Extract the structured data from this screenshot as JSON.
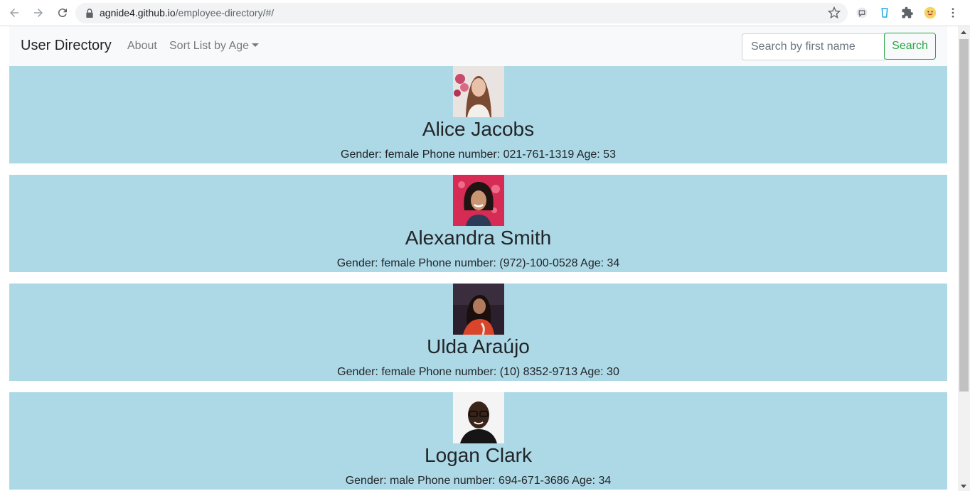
{
  "browser": {
    "url_host": "agnide4.github.io",
    "url_path": "/employee-directory/#/"
  },
  "navbar": {
    "brand": "User Directory",
    "about": "About",
    "sort": "Sort List by Age",
    "search_placeholder": "Search by first name",
    "search_button": "Search"
  },
  "colors": {
    "card_bg": "#add8e6",
    "accent_green": "#28a745"
  },
  "users": [
    {
      "name": "Alice Jacobs",
      "details": "Gender: female Phone number: 021-761-1319 Age: 53"
    },
    {
      "name": "Alexandra Smith",
      "details": "Gender: female Phone number: (972)-100-0528 Age: 34"
    },
    {
      "name": "Ulda Araújo",
      "details": "Gender: female Phone number: (10) 8352-9713 Age: 30"
    },
    {
      "name": "Logan Clark",
      "details": "Gender: male Phone number: 694-671-3686 Age: 34"
    }
  ]
}
